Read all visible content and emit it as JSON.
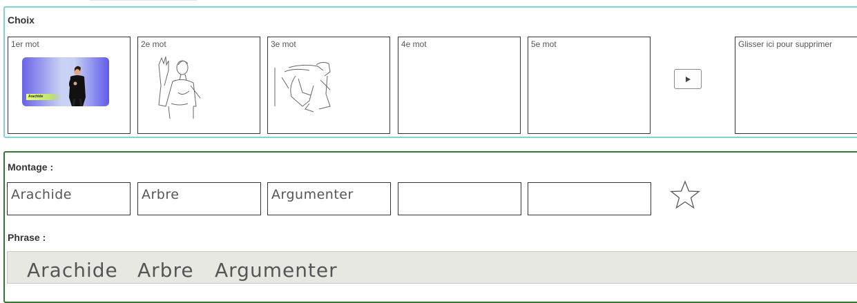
{
  "choix": {
    "title": "Choix",
    "slots": [
      {
        "label": "1er mot",
        "content": "video",
        "video_caption": "Arachide"
      },
      {
        "label": "2e mot",
        "content": "sketch-raised-hand"
      },
      {
        "label": "3e mot",
        "content": "sketch-arms-gesture"
      },
      {
        "label": "4e mot",
        "content": "empty"
      },
      {
        "label": "5e mot",
        "content": "empty"
      }
    ],
    "play_icon": "play-icon",
    "trash_label": "Glisser ici pour supprimer"
  },
  "montage": {
    "title": "Montage :",
    "words": [
      "Arachide",
      "Arbre",
      "Argumenter",
      "",
      ""
    ],
    "star_icon": "star-outline-icon"
  },
  "phrase": {
    "title": "Phrase :",
    "words": [
      "Arachide",
      "Arbre",
      "Argumenter"
    ]
  },
  "colors": {
    "choix_border": "#7fd3d3",
    "montage_border": "#2f7a2f",
    "phrase_bg": "#e8e8e3"
  }
}
